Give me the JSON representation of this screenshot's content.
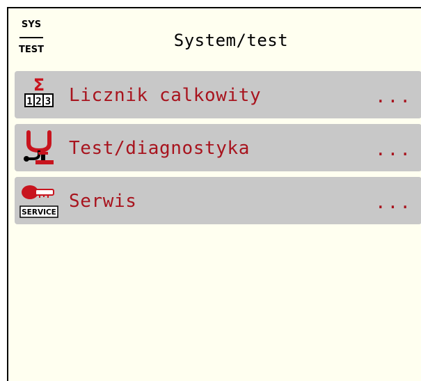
{
  "header": {
    "icon_top": "SYS",
    "icon_bottom": "TEST",
    "title": "System/test"
  },
  "menu": {
    "items": [
      {
        "label": "Licznik calkowity",
        "more": "...",
        "icon": "sum-counter-icon"
      },
      {
        "label": "Test/diagnostyka",
        "more": "...",
        "icon": "diagnostics-icon"
      },
      {
        "label": "Serwis",
        "more": "...",
        "icon": "service-key-icon",
        "icon_text": "SERVICE"
      }
    ]
  },
  "colors": {
    "label": "#a8141e",
    "row_bg": "#c8c8c8",
    "panel_bg": "#fffff0",
    "icon_red": "#c8141e"
  }
}
